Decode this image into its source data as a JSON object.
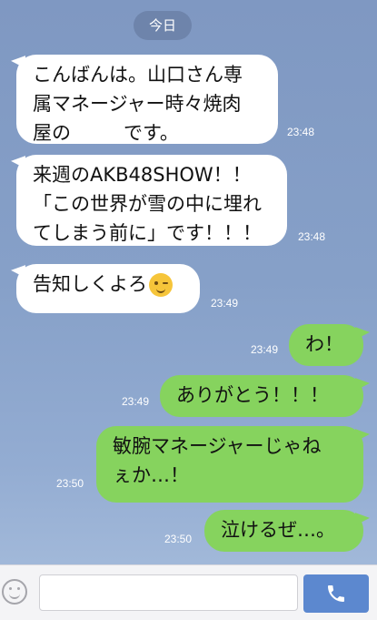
{
  "date_label": "今日",
  "messages": [
    {
      "side": "in",
      "time": "23:48",
      "lines": [
        "こんばんは。山口さん専",
        "属マネージャー時々焼肉",
        "屋の",
        "です。"
      ]
    },
    {
      "side": "in",
      "time": "23:48",
      "lines": [
        "来週のAKB48SHOW！！",
        "「この世界が雪の中に埋れ",
        "てしまう前に」です！！！"
      ]
    },
    {
      "side": "in",
      "time": "23:49",
      "lines": [
        "告知しくよろ"
      ],
      "emoji": "winking-face"
    },
    {
      "side": "out",
      "time": "23:49",
      "lines": [
        "わ！"
      ]
    },
    {
      "side": "out",
      "time": "23:49",
      "lines": [
        "ありがとう！！！"
      ]
    },
    {
      "side": "out",
      "time": "23:50",
      "lines": [
        "敏腕マネージャーじゃね",
        "ぇか…！"
      ]
    },
    {
      "side": "out",
      "time": "23:50",
      "lines": [
        "泣けるぜ…。"
      ]
    }
  ],
  "composer": {
    "value": "",
    "placeholder": ""
  },
  "colors": {
    "incoming": "#ffffff",
    "outgoing": "#86d35e",
    "send": "#5c88cf",
    "background": "#86a0c8"
  }
}
